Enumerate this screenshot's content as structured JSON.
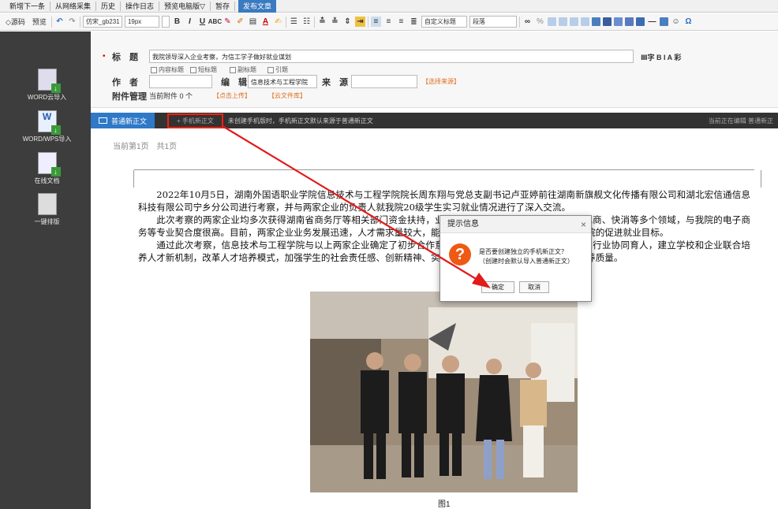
{
  "menu": {
    "items": [
      "新增下一条",
      "从网络采集",
      "历史",
      "操作日志",
      "预览电脑版▽",
      "暂存"
    ],
    "publish": "发布文章"
  },
  "toolbar": {
    "source": "◇源码",
    "preview": "预览",
    "font": "仿宋_gb231",
    "size": "19px",
    "heading_style": "自定义标题",
    "paragraph": "段落"
  },
  "sidebar": {
    "items": [
      {
        "label": "WORD云导入"
      },
      {
        "label": "WORD/WPS导入"
      },
      {
        "label": "在线文档"
      },
      {
        "label": "一键排版"
      }
    ]
  },
  "form": {
    "title_label": "标　题",
    "title_value": "我院领导深入企业考察，为信工学子做好就业谋划",
    "title_tools": "Ⅲ字 B I A 彩",
    "options": [
      "内容标题",
      "短标题",
      "副标题",
      "引题"
    ],
    "author_label": "作　者",
    "editor_label": "编　辑",
    "editor_value": "信息技术与工程学院",
    "source_label": "来　源",
    "source_link": "【选择来源】",
    "attach_label": "附件管理",
    "attach_count": "当前附件 0 个",
    "upload_link": "【点击上传】",
    "cloud_link": "【云文件库】"
  },
  "tabs": {
    "normal": "普通新正文",
    "mobile": "+ 手机新正文",
    "hint": "未创建手机版时，手机新正文默认来源于普通新正文",
    "right": "当前正在编辑  普通新正"
  },
  "pageinfo": "当前第1页　共1页",
  "article": {
    "paragraphs": [
      "2022年10月5日，湖南外国语职业学院信息技术与工程学院院长周东翔与党总支副书记卢亚婷前往湖南新旗舰文化传播有限公司和湖北宏信通信息科技有限公司宁乡分公司进行考察，并与两家企业的负责人就我院20级学生实习就业情况进行了深入交流。",
      "此次考察的两家企业均多次获得湖南省商务厅等相关部门资金扶持，业务范围涵盖运营商、金融、保险、电商、快消等多个领域，与我院的电子商务等专业契合度很高。目前，两家企业业务发展迅速，人才需求量较大，能满足较多毕业生实习与就业，符合我院的促进就业目标。",
      "通过此次考察，信息技术与工程学院与以上两家企业确定了初步合作意向。今后学院将促进学校和信息技术行业协同育人，建立学校和企业联合培养人才新机制，改革人才培养模式，加强学生的社会责任感、创新精神、实践能力和就业能力，不断提高人才培养质量。"
    ],
    "caption": "图1"
  },
  "dialog": {
    "title": "提示信息",
    "line1": "是否要创建独立的手机新正文？",
    "line2": "（创建时会默认导入普通新正文）",
    "ok": "确定",
    "cancel": "取消"
  },
  "colors": {
    "accent": "#2f79c7",
    "arrow": "#e21b1b",
    "sidebar": "#3d3d3d",
    "warning_icon": "#ee5a14"
  }
}
